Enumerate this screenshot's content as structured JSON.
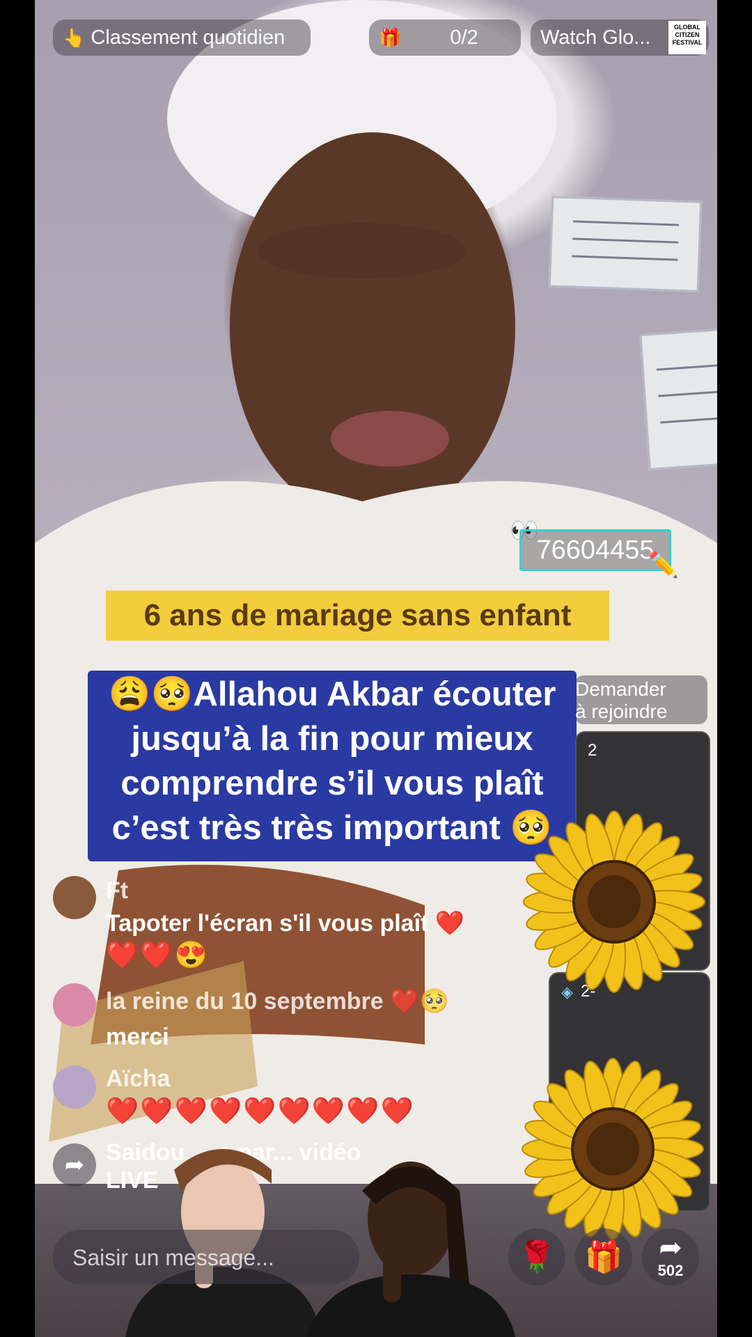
{
  "top": {
    "ranking_label": "Classement quotidien",
    "ranking_icon": "finger-point-icon",
    "goal_count": "0/2",
    "watch_label": "Watch Glo...",
    "festival_badge": [
      "GLOBAL",
      "CITIZEN",
      "FESTIVAL"
    ]
  },
  "overlay": {
    "phone_number": "76604455",
    "caption_title": "6 ans de mariage sans enfant",
    "caption_lines": [
      "😩🥺Allahou Akbar écouter",
      "jusqu’à la fin pour mieux",
      "comprendre s’il vous plaît",
      "c’est très très important 🥺"
    ]
  },
  "side_panel": {
    "join_label_1": "Demander",
    "join_label_2": "à rejoindre",
    "card1_count": "2",
    "card2_count": "2-"
  },
  "comments": [
    {
      "name": "Ft",
      "text": "Tapoter l'écran s'il vous plaît ❤️",
      "extra": "❤️❤️😍"
    },
    {
      "name": "la reine du 10 septembre ❤️🥺",
      "text": "merci"
    },
    {
      "name": "Aïcha",
      "text": "❤️❤️❤️❤️❤️❤️❤️❤️❤️"
    },
    {
      "name": "Saidou",
      "text": "Saidou ... a par... vidéo",
      "extra": "LIVE"
    }
  ],
  "bottom": {
    "input_placeholder": "Saisir un message...",
    "share_count": "502"
  },
  "colors": {
    "caption_yellow": "#f2cd3c",
    "caption_blue": "#2a3aa3",
    "heart_red": "#e11111",
    "phone_border": "#2fd3cf"
  }
}
